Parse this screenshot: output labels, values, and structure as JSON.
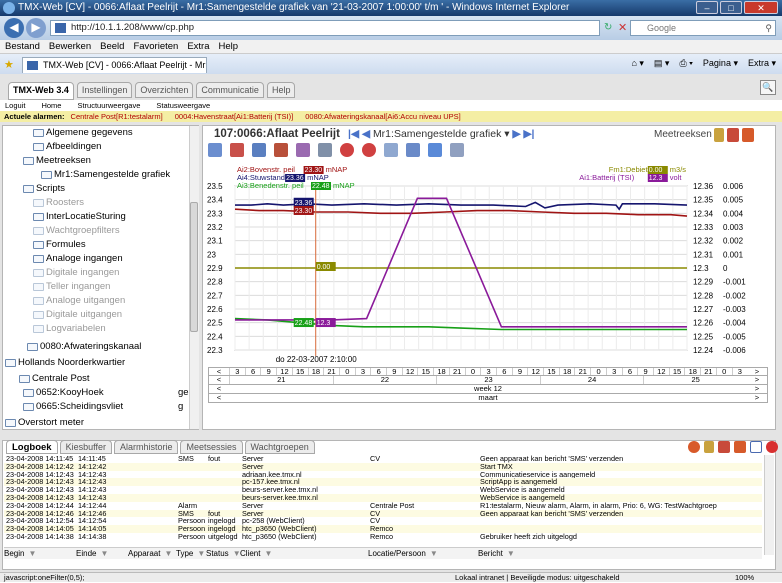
{
  "browser": {
    "title": "TMX-Web [CV] - 0066:Aflaat Peelrijt - Mr1:Samengestelde grafiek van '21-03-2007 1:00:00' t/m ' - Windows Internet Explorer",
    "url": "http://10.1.1.208/www/cp.php",
    "search_placeholder": "Google",
    "menu": [
      "Bestand",
      "Bewerken",
      "Beeld",
      "Favorieten",
      "Extra",
      "Help"
    ],
    "tab_title": "TMX-Web [CV] - 0066:Aflaat Peelrijt - Mr1:Samen...",
    "right_tools": [
      "Pagina ▾",
      "Extra ▾"
    ],
    "status_left": "javascript:oneFilter(0,5);",
    "status_zone": "Lokaal intranet | Beveiligde modus: uitgeschakeld",
    "zoom": "100%"
  },
  "app": {
    "tabs": [
      "TMX-Web 3.4",
      "Instellingen",
      "Overzichten",
      "Communicatie",
      "Help"
    ],
    "subnav": [
      "Loguit",
      "Home",
      "Structuurweergave",
      "Statusweergave"
    ],
    "alarm_label": "Actuele alarmen:",
    "alarms": [
      "Centrale Post[R1:testalarm]",
      "0004:Havenstraat[Ai1:Batterij (TSI)]",
      "0080:Afwateringskanaal[Ai6:Accu niveau UPS]"
    ]
  },
  "tree": [
    {
      "label": "Algemene gegevens",
      "gray": false
    },
    {
      "label": "Afbeeldingen",
      "gray": false
    },
    {
      "label": "Meetreeksen",
      "gray": false
    },
    {
      "label": "Mr1:Samengestelde grafiek",
      "gray": false
    },
    {
      "label": "Scripts",
      "gray": false
    },
    {
      "label": "Roosters",
      "gray": true
    },
    {
      "label": "InterLocatieSturing",
      "gray": false
    },
    {
      "label": "Wachtgroepfilters",
      "gray": true
    },
    {
      "label": "Formules",
      "gray": false
    },
    {
      "label": "Analoge ingangen",
      "gray": false
    },
    {
      "label": "Digitale ingangen",
      "gray": true
    },
    {
      "label": "Teller ingangen",
      "gray": true
    },
    {
      "label": "Analoge uitgangen",
      "gray": true
    },
    {
      "label": "Digitale uitgangen",
      "gray": true
    },
    {
      "label": "Logvariabelen",
      "gray": true
    },
    {
      "label": "0080:Afwateringskanaal",
      "gray": false
    },
    {
      "label": "Hollands Noorderkwartier",
      "gray": false
    },
    {
      "label": "Centrale Post",
      "gray": false
    },
    {
      "label": "0652:KooyHoek",
      "gray": false,
      "suffix": "ge"
    },
    {
      "label": "0665:Scheidingsvliet",
      "gray": false,
      "suffix": "g"
    },
    {
      "label": "Overstort meter",
      "gray": false
    },
    {
      "label": "Centrale Post",
      "gray": false
    },
    {
      "label": "0004:Havenstraat",
      "gray": false
    }
  ],
  "chart_panel": {
    "title": "107:0066:Aflaat Peelrijt",
    "nav_label": "Mr1:Samengestelde grafiek ▾",
    "meetreeksen": "Meetreeksen ▾"
  },
  "chart_data": {
    "type": "line",
    "legend_left": [
      {
        "label": "Ai2:Bovenstr. peil",
        "value": "23.30",
        "unit": "mNAP",
        "color": "#a01414"
      },
      {
        "label": "Ai4:Stuwstand",
        "value": "23.36",
        "unit": "mNAP",
        "color": "#15156e"
      },
      {
        "label": "Ai3:Benedenstr. peil",
        "value": "22.48",
        "unit": "mNAP",
        "color": "#18a018"
      }
    ],
    "legend_right": [
      {
        "label": "Fm1:Debiet",
        "value": "0.00",
        "unit": "m3/s",
        "color": "#8a8a00"
      },
      {
        "label": "Ai1:Batterij (TSI)",
        "value": "12.3",
        "unit": "volt",
        "color": "#8a1a9a"
      }
    ],
    "y_left": {
      "ticks": [
        "23.5",
        "23.4",
        "23.3",
        "23.2",
        "23.1",
        "23",
        "22.9",
        "22.8",
        "22.7",
        "22.6",
        "22.5",
        "22.4",
        "22.3"
      ],
      "range": [
        22.3,
        23.5
      ]
    },
    "y_right_volt": {
      "ticks": [
        "12.36",
        "12.35",
        "12.34",
        "12.33",
        "12.32",
        "12.31",
        "12.3",
        "12.29",
        "12.28",
        "12.27",
        "12.26",
        "12.25",
        "12.24"
      ],
      "range": [
        12.24,
        12.36
      ]
    },
    "y_right_flow": {
      "ticks": [
        "0.006",
        "0.005",
        "0.004",
        "0.003",
        "0.002",
        "0.001",
        "0",
        "-0.001",
        "-0.002",
        "-0.003",
        "-0.004",
        "-0.005",
        "-0.006"
      ],
      "range": [
        -0.006,
        0.006
      ]
    },
    "cursor_label": "do 22-03-2007 2:10:00",
    "cursor_values": [
      {
        "value": "23.36",
        "color": "#15156e"
      },
      {
        "value": "23.30",
        "color": "#a01414"
      },
      {
        "value": "0.00",
        "color": "#8a8a00"
      },
      {
        "value": "22.48",
        "color": "#18a018"
      },
      {
        "value": "12.3",
        "color": "#8a1a9a"
      }
    ],
    "x_hours": [
      "3",
      "6",
      "9",
      "12",
      "15",
      "18",
      "21",
      "0",
      "3",
      "6",
      "9",
      "12",
      "15",
      "18",
      "21",
      "0",
      "3",
      "6",
      "9",
      "12",
      "15",
      "18",
      "21",
      "0",
      "3",
      "6",
      "9",
      "12",
      "15",
      "18",
      "21",
      "0",
      "3"
    ],
    "x_days": [
      "21",
      "22",
      "23",
      "24",
      "25"
    ],
    "x_week": "week 12",
    "x_month": "maart",
    "series": [
      {
        "name": "Ai4:Stuwstand",
        "color": "#15156e",
        "points": [
          [
            0,
            23.36
          ],
          [
            20,
            23.36
          ],
          [
            40,
            23.37
          ],
          [
            60,
            23.36
          ],
          [
            90,
            23.37
          ],
          [
            120,
            23.36
          ],
          [
            160,
            23.37
          ],
          [
            200,
            23.36
          ],
          [
            240,
            23.37
          ],
          [
            280,
            23.36
          ],
          [
            320,
            23.36
          ],
          [
            360,
            23.35
          ],
          [
            372,
            23.38
          ],
          [
            384,
            23.34
          ],
          [
            400,
            23.36
          ],
          [
            440,
            23.37
          ],
          [
            472,
            23.36
          ],
          [
            476,
            23.33
          ],
          [
            480,
            23.37
          ],
          [
            520,
            23.37
          ],
          [
            560,
            23.36
          ]
        ]
      },
      {
        "name": "Ai2:Bovenstr. peil",
        "color": "#a01414",
        "points": [
          [
            0,
            23.33
          ],
          [
            30,
            23.32
          ],
          [
            60,
            23.32
          ],
          [
            100,
            23.31
          ],
          [
            140,
            23.31
          ],
          [
            180,
            23.3
          ],
          [
            220,
            23.3
          ],
          [
            260,
            23.31
          ],
          [
            300,
            23.32
          ],
          [
            340,
            23.32
          ],
          [
            380,
            23.31
          ],
          [
            420,
            23.3
          ],
          [
            460,
            23.3
          ],
          [
            500,
            23.29
          ],
          [
            540,
            23.29
          ],
          [
            560,
            23.28
          ]
        ]
      },
      {
        "name": "Ai3:Benedenstr. peil",
        "color": "#18a018",
        "points": [
          [
            0,
            22.53
          ],
          [
            40,
            22.52
          ],
          [
            80,
            22.5
          ],
          [
            120,
            22.48
          ],
          [
            160,
            22.47
          ],
          [
            200,
            22.47
          ],
          [
            240,
            22.47
          ],
          [
            280,
            22.46
          ],
          [
            330,
            22.45
          ],
          [
            360,
            22.45
          ],
          [
            420,
            22.45
          ],
          [
            480,
            22.45
          ],
          [
            560,
            22.45
          ]
        ]
      },
      {
        "name": "Fm1:Debiet",
        "color": "#8a8a00",
        "points": [
          [
            0,
            0
          ],
          [
            560,
            0
          ]
        ]
      },
      {
        "name": "Ai1:Batterij (TSI)",
        "color": "#8a1a9a",
        "points": [
          [
            0,
            12.262
          ],
          [
            120,
            12.262
          ],
          [
            163,
            12.263
          ],
          [
            226,
            12.351
          ],
          [
            262,
            12.351
          ],
          [
            330,
            12.257
          ],
          [
            560,
            12.257
          ]
        ]
      }
    ]
  },
  "log": {
    "tabs": [
      "Logboek",
      "Kiesbuffer",
      "Alarmhistorie",
      "Meetsessies",
      "Wachtgroepen"
    ],
    "columns": [
      "Begin",
      "Einde",
      "Apparaat",
      "Type",
      "Status",
      "Client",
      "",
      "Locatie/Persoon",
      "Bericht"
    ],
    "rows": [
      [
        "23-04-2008 14:11:45",
        "14:11:45",
        "",
        "SMS",
        "fout",
        "Server",
        "",
        "CV",
        "Geen apparaat kan bericht 'SMS' verzenden"
      ],
      [
        "23-04-2008 14:12:42",
        "14:12:42",
        "",
        "",
        "",
        "Server",
        "",
        "",
        "Start TMX"
      ],
      [
        "23-04-2008 14:12:43",
        "14:12:43",
        "",
        "",
        "",
        "adriaan.kee.tmx.nl",
        "",
        "",
        "Communicatieservice is aangemeld"
      ],
      [
        "23-04-2008 14:12:43",
        "14:12:43",
        "",
        "",
        "",
        "pc-157.kee.tmx.nl",
        "",
        "",
        "ScriptApp is aangemeld"
      ],
      [
        "23-04-2008 14:12:43",
        "14:12:43",
        "",
        "",
        "",
        "beurs-server.kee.tmx.nl",
        "",
        "",
        "WebService is aangemeld"
      ],
      [
        "23-04-2008 14:12:43",
        "14:12:43",
        "",
        "",
        "",
        "beurs-server.kee.tmx.nl",
        "",
        "",
        "WebService is aangemeld"
      ],
      [
        "23-04-2008 14:12:44",
        "14:12:44",
        "",
        "Alarm",
        "",
        "Server",
        "",
        "Centrale Post",
        "R1:testalarm, Nieuw alarm, Alarm, in alarm, Prio: 6, WG: TestWachtgroep"
      ],
      [
        "23-04-2008 14:12:46",
        "14:12:46",
        "",
        "SMS",
        "fout",
        "Server",
        "",
        "CV",
        "Geen apparaat kan bericht 'SMS' verzenden"
      ],
      [
        "23-04-2008 14:12:54",
        "14:12:54",
        "",
        "Persoon",
        "ingelogd",
        "pc-258 (WebClient)",
        "",
        "CV",
        ""
      ],
      [
        "23-04-2008 14:14:05",
        "14:14:05",
        "",
        "Persoon",
        "ingelogd",
        "htc_p3650 (WebClient)",
        "",
        "Remco",
        ""
      ],
      [
        "23-04-2008 14:14:38",
        "14:14:38",
        "",
        "Persoon",
        "uitgelogd",
        "htc_p3650 (WebClient)",
        "",
        "Remco",
        "Gebruiker heeft zich uitgelogd"
      ]
    ]
  }
}
